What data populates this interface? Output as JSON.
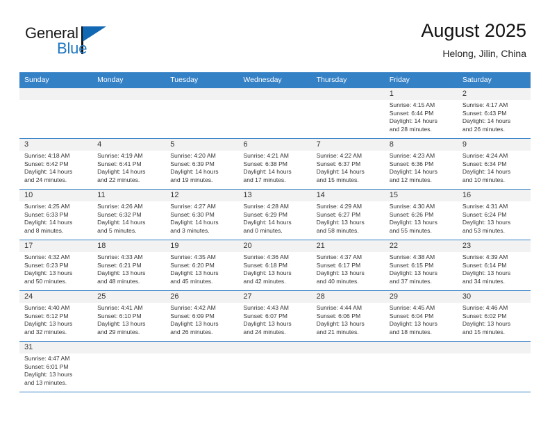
{
  "logo": {
    "word_one": "General",
    "word_two": "Blue",
    "colors": {
      "dark": "#1a1a1a",
      "blue": "#2077c1",
      "flag": "#1268b3"
    }
  },
  "header": {
    "title": "August 2025",
    "subtitle": "Helong, Jilin, China"
  },
  "theme": {
    "header_bg": "#3581c6",
    "header_text": "#ffffff",
    "daynum_bg": "#f2f2f2",
    "grid_line": "#3581c6",
    "cell_text": "#333333"
  },
  "weekdays": [
    "Sunday",
    "Monday",
    "Tuesday",
    "Wednesday",
    "Thursday",
    "Friday",
    "Saturday"
  ],
  "weeks": [
    [
      {
        "day": "",
        "blank": true,
        "sunrise": "",
        "sunset": "",
        "daylight_line1": "",
        "daylight_line2": ""
      },
      {
        "day": "",
        "blank": true,
        "sunrise": "",
        "sunset": "",
        "daylight_line1": "",
        "daylight_line2": ""
      },
      {
        "day": "",
        "blank": true,
        "sunrise": "",
        "sunset": "",
        "daylight_line1": "",
        "daylight_line2": ""
      },
      {
        "day": "",
        "blank": true,
        "sunrise": "",
        "sunset": "",
        "daylight_line1": "",
        "daylight_line2": ""
      },
      {
        "day": "",
        "blank": true,
        "sunrise": "",
        "sunset": "",
        "daylight_line1": "",
        "daylight_line2": ""
      },
      {
        "day": "1",
        "blank": false,
        "sunrise": "Sunrise: 4:15 AM",
        "sunset": "Sunset: 6:44 PM",
        "daylight_line1": "Daylight: 14 hours",
        "daylight_line2": "and 28 minutes."
      },
      {
        "day": "2",
        "blank": false,
        "sunrise": "Sunrise: 4:17 AM",
        "sunset": "Sunset: 6:43 PM",
        "daylight_line1": "Daylight: 14 hours",
        "daylight_line2": "and 26 minutes."
      }
    ],
    [
      {
        "day": "3",
        "blank": false,
        "sunrise": "Sunrise: 4:18 AM",
        "sunset": "Sunset: 6:42 PM",
        "daylight_line1": "Daylight: 14 hours",
        "daylight_line2": "and 24 minutes."
      },
      {
        "day": "4",
        "blank": false,
        "sunrise": "Sunrise: 4:19 AM",
        "sunset": "Sunset: 6:41 PM",
        "daylight_line1": "Daylight: 14 hours",
        "daylight_line2": "and 22 minutes."
      },
      {
        "day": "5",
        "blank": false,
        "sunrise": "Sunrise: 4:20 AM",
        "sunset": "Sunset: 6:39 PM",
        "daylight_line1": "Daylight: 14 hours",
        "daylight_line2": "and 19 minutes."
      },
      {
        "day": "6",
        "blank": false,
        "sunrise": "Sunrise: 4:21 AM",
        "sunset": "Sunset: 6:38 PM",
        "daylight_line1": "Daylight: 14 hours",
        "daylight_line2": "and 17 minutes."
      },
      {
        "day": "7",
        "blank": false,
        "sunrise": "Sunrise: 4:22 AM",
        "sunset": "Sunset: 6:37 PM",
        "daylight_line1": "Daylight: 14 hours",
        "daylight_line2": "and 15 minutes."
      },
      {
        "day": "8",
        "blank": false,
        "sunrise": "Sunrise: 4:23 AM",
        "sunset": "Sunset: 6:36 PM",
        "daylight_line1": "Daylight: 14 hours",
        "daylight_line2": "and 12 minutes."
      },
      {
        "day": "9",
        "blank": false,
        "sunrise": "Sunrise: 4:24 AM",
        "sunset": "Sunset: 6:34 PM",
        "daylight_line1": "Daylight: 14 hours",
        "daylight_line2": "and 10 minutes."
      }
    ],
    [
      {
        "day": "10",
        "blank": false,
        "sunrise": "Sunrise: 4:25 AM",
        "sunset": "Sunset: 6:33 PM",
        "daylight_line1": "Daylight: 14 hours",
        "daylight_line2": "and 8 minutes."
      },
      {
        "day": "11",
        "blank": false,
        "sunrise": "Sunrise: 4:26 AM",
        "sunset": "Sunset: 6:32 PM",
        "daylight_line1": "Daylight: 14 hours",
        "daylight_line2": "and 5 minutes."
      },
      {
        "day": "12",
        "blank": false,
        "sunrise": "Sunrise: 4:27 AM",
        "sunset": "Sunset: 6:30 PM",
        "daylight_line1": "Daylight: 14 hours",
        "daylight_line2": "and 3 minutes."
      },
      {
        "day": "13",
        "blank": false,
        "sunrise": "Sunrise: 4:28 AM",
        "sunset": "Sunset: 6:29 PM",
        "daylight_line1": "Daylight: 14 hours",
        "daylight_line2": "and 0 minutes."
      },
      {
        "day": "14",
        "blank": false,
        "sunrise": "Sunrise: 4:29 AM",
        "sunset": "Sunset: 6:27 PM",
        "daylight_line1": "Daylight: 13 hours",
        "daylight_line2": "and 58 minutes."
      },
      {
        "day": "15",
        "blank": false,
        "sunrise": "Sunrise: 4:30 AM",
        "sunset": "Sunset: 6:26 PM",
        "daylight_line1": "Daylight: 13 hours",
        "daylight_line2": "and 55 minutes."
      },
      {
        "day": "16",
        "blank": false,
        "sunrise": "Sunrise: 4:31 AM",
        "sunset": "Sunset: 6:24 PM",
        "daylight_line1": "Daylight: 13 hours",
        "daylight_line2": "and 53 minutes."
      }
    ],
    [
      {
        "day": "17",
        "blank": false,
        "sunrise": "Sunrise: 4:32 AM",
        "sunset": "Sunset: 6:23 PM",
        "daylight_line1": "Daylight: 13 hours",
        "daylight_line2": "and 50 minutes."
      },
      {
        "day": "18",
        "blank": false,
        "sunrise": "Sunrise: 4:33 AM",
        "sunset": "Sunset: 6:21 PM",
        "daylight_line1": "Daylight: 13 hours",
        "daylight_line2": "and 48 minutes."
      },
      {
        "day": "19",
        "blank": false,
        "sunrise": "Sunrise: 4:35 AM",
        "sunset": "Sunset: 6:20 PM",
        "daylight_line1": "Daylight: 13 hours",
        "daylight_line2": "and 45 minutes."
      },
      {
        "day": "20",
        "blank": false,
        "sunrise": "Sunrise: 4:36 AM",
        "sunset": "Sunset: 6:18 PM",
        "daylight_line1": "Daylight: 13 hours",
        "daylight_line2": "and 42 minutes."
      },
      {
        "day": "21",
        "blank": false,
        "sunrise": "Sunrise: 4:37 AM",
        "sunset": "Sunset: 6:17 PM",
        "daylight_line1": "Daylight: 13 hours",
        "daylight_line2": "and 40 minutes."
      },
      {
        "day": "22",
        "blank": false,
        "sunrise": "Sunrise: 4:38 AM",
        "sunset": "Sunset: 6:15 PM",
        "daylight_line1": "Daylight: 13 hours",
        "daylight_line2": "and 37 minutes."
      },
      {
        "day": "23",
        "blank": false,
        "sunrise": "Sunrise: 4:39 AM",
        "sunset": "Sunset: 6:14 PM",
        "daylight_line1": "Daylight: 13 hours",
        "daylight_line2": "and 34 minutes."
      }
    ],
    [
      {
        "day": "24",
        "blank": false,
        "sunrise": "Sunrise: 4:40 AM",
        "sunset": "Sunset: 6:12 PM",
        "daylight_line1": "Daylight: 13 hours",
        "daylight_line2": "and 32 minutes."
      },
      {
        "day": "25",
        "blank": false,
        "sunrise": "Sunrise: 4:41 AM",
        "sunset": "Sunset: 6:10 PM",
        "daylight_line1": "Daylight: 13 hours",
        "daylight_line2": "and 29 minutes."
      },
      {
        "day": "26",
        "blank": false,
        "sunrise": "Sunrise: 4:42 AM",
        "sunset": "Sunset: 6:09 PM",
        "daylight_line1": "Daylight: 13 hours",
        "daylight_line2": "and 26 minutes."
      },
      {
        "day": "27",
        "blank": false,
        "sunrise": "Sunrise: 4:43 AM",
        "sunset": "Sunset: 6:07 PM",
        "daylight_line1": "Daylight: 13 hours",
        "daylight_line2": "and 24 minutes."
      },
      {
        "day": "28",
        "blank": false,
        "sunrise": "Sunrise: 4:44 AM",
        "sunset": "Sunset: 6:06 PM",
        "daylight_line1": "Daylight: 13 hours",
        "daylight_line2": "and 21 minutes."
      },
      {
        "day": "29",
        "blank": false,
        "sunrise": "Sunrise: 4:45 AM",
        "sunset": "Sunset: 6:04 PM",
        "daylight_line1": "Daylight: 13 hours",
        "daylight_line2": "and 18 minutes."
      },
      {
        "day": "30",
        "blank": false,
        "sunrise": "Sunrise: 4:46 AM",
        "sunset": "Sunset: 6:02 PM",
        "daylight_line1": "Daylight: 13 hours",
        "daylight_line2": "and 15 minutes."
      }
    ],
    [
      {
        "day": "31",
        "blank": false,
        "sunrise": "Sunrise: 4:47 AM",
        "sunset": "Sunset: 6:01 PM",
        "daylight_line1": "Daylight: 13 hours",
        "daylight_line2": "and 13 minutes."
      },
      {
        "day": "",
        "blank": true,
        "sunrise": "",
        "sunset": "",
        "daylight_line1": "",
        "daylight_line2": ""
      },
      {
        "day": "",
        "blank": true,
        "sunrise": "",
        "sunset": "",
        "daylight_line1": "",
        "daylight_line2": ""
      },
      {
        "day": "",
        "blank": true,
        "sunrise": "",
        "sunset": "",
        "daylight_line1": "",
        "daylight_line2": ""
      },
      {
        "day": "",
        "blank": true,
        "sunrise": "",
        "sunset": "",
        "daylight_line1": "",
        "daylight_line2": ""
      },
      {
        "day": "",
        "blank": true,
        "sunrise": "",
        "sunset": "",
        "daylight_line1": "",
        "daylight_line2": ""
      },
      {
        "day": "",
        "blank": true,
        "sunrise": "",
        "sunset": "",
        "daylight_line1": "",
        "daylight_line2": ""
      }
    ]
  ]
}
